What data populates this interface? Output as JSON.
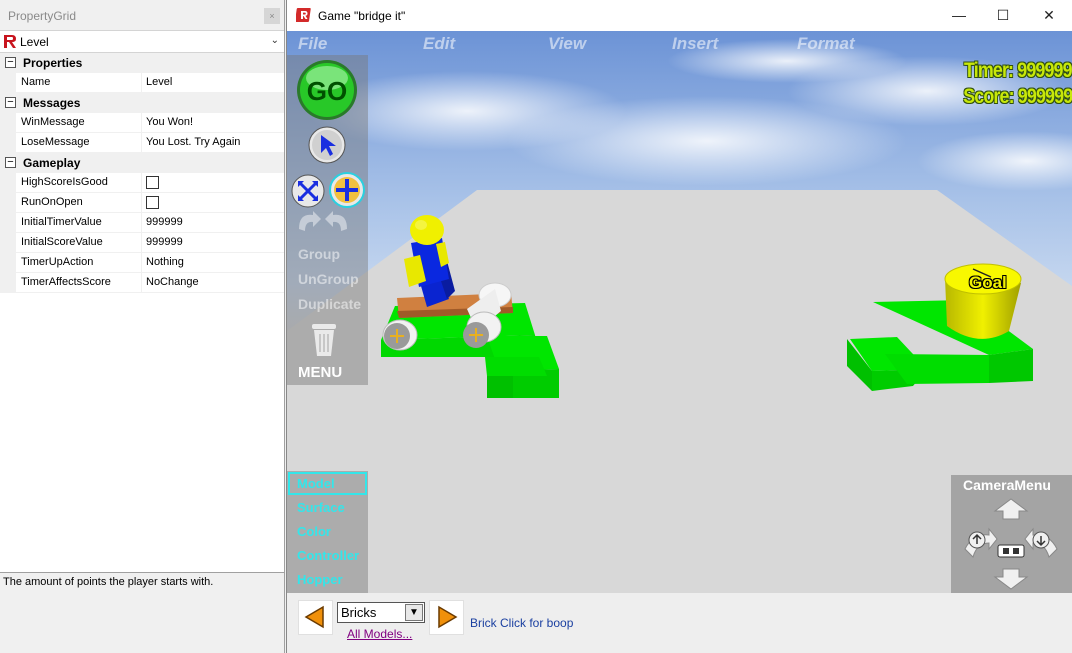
{
  "property_grid": {
    "title": "PropertyGrid",
    "selected_object": "Level",
    "categories": [
      {
        "label": "Properties",
        "rows": [
          {
            "name": "Name",
            "value": "Level"
          }
        ]
      },
      {
        "label": "Messages",
        "rows": [
          {
            "name": "WinMessage",
            "value": "You Won!"
          },
          {
            "name": "LoseMessage",
            "value": "You Lost. Try Again"
          }
        ]
      },
      {
        "label": "Gameplay",
        "rows": [
          {
            "name": "HighScoreIsGood",
            "value": "",
            "checkbox": true,
            "checked": false
          },
          {
            "name": "RunOnOpen",
            "value": "",
            "checkbox": true,
            "checked": false
          },
          {
            "name": "InitialTimerValue",
            "value": "999999"
          },
          {
            "name": "InitialScoreValue",
            "value": "999999"
          },
          {
            "name": "TimerUpAction",
            "value": "Nothing"
          },
          {
            "name": "TimerAffectsScore",
            "value": "NoChange"
          }
        ]
      }
    ],
    "description": "The amount of points the player starts with."
  },
  "game_window": {
    "title": "Game \"bridge it\"",
    "controls": {
      "minimize": "—",
      "maximize": "☐",
      "close": "✕"
    },
    "menu": [
      "File",
      "Edit",
      "View",
      "Insert",
      "Format"
    ],
    "hud": {
      "timer": "Timer: 999999",
      "score": "Score: 999999"
    },
    "toolbar": {
      "go": "GO",
      "group": "Group",
      "ungroup": "UnGroup",
      "duplicate": "Duplicate",
      "menu": "MENU"
    },
    "palette": [
      "Model",
      "Surface",
      "Color",
      "Controller",
      "Hopper"
    ],
    "camera_menu": "CameraMenu",
    "goal_label": "Goal",
    "bottom": {
      "selected_category": "Bricks",
      "all_models": "All Models...",
      "hint": "Brick Click for boop"
    }
  }
}
